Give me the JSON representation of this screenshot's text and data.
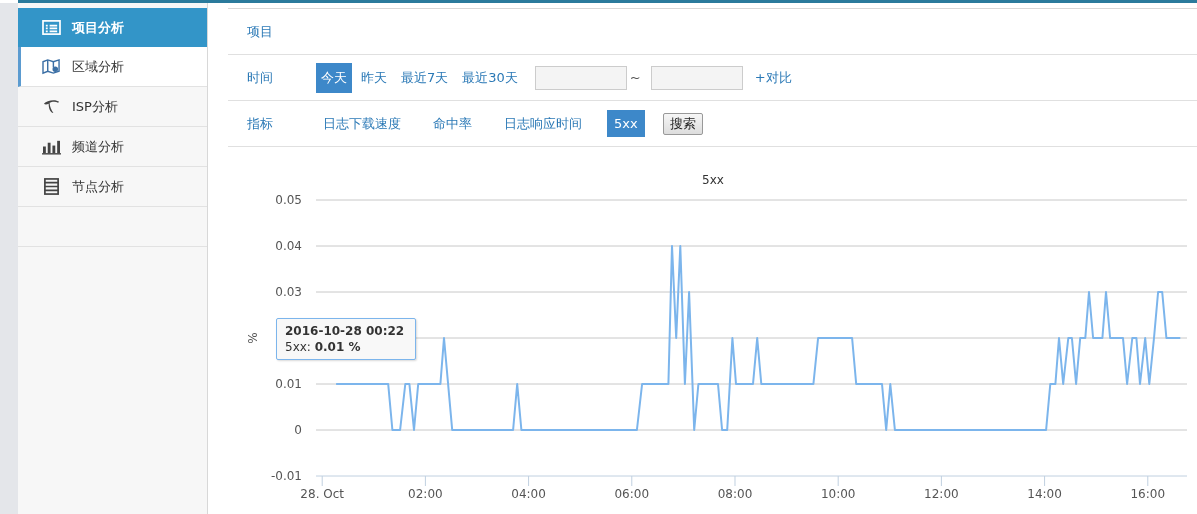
{
  "sidebar": {
    "items": [
      {
        "label": "项目分析",
        "kind": "list",
        "selected": true,
        "highlighted": false
      },
      {
        "label": "区域分析",
        "kind": "map",
        "selected": false,
        "highlighted": true
      },
      {
        "label": "ISP分析",
        "kind": "telecom",
        "selected": false,
        "highlighted": false
      },
      {
        "label": "频道分析",
        "kind": "bars",
        "selected": false,
        "highlighted": false
      },
      {
        "label": "节点分析",
        "kind": "server",
        "selected": false,
        "highlighted": false
      }
    ]
  },
  "filters": {
    "project": {
      "label": "项目"
    },
    "time": {
      "label": "时间",
      "options": [
        {
          "label": "今天",
          "selected": true
        },
        {
          "label": "昨天",
          "selected": false
        },
        {
          "label": "最近7天",
          "selected": false
        },
        {
          "label": "最近30天",
          "selected": false
        }
      ],
      "range_separator": "~",
      "compare": "+对比"
    },
    "metric": {
      "label": "指标",
      "options": [
        {
          "label": "日志下载速度",
          "selected": false
        },
        {
          "label": "命中率",
          "selected": false
        },
        {
          "label": "日志响应时间",
          "selected": false
        },
        {
          "label": "5xx",
          "selected": true
        }
      ],
      "search_button": "搜索"
    }
  },
  "chart": {
    "tooltip": {
      "title": "2016-10-28 00:22",
      "separator": ":",
      "value": "0.01 %"
    },
    "chart_data": {
      "type": "line",
      "grid": true,
      "title": "5xx",
      "ylabel": "%",
      "xlim": [
        -0.12,
        16.76
      ],
      "ylim": [
        -0.01,
        0.05
      ],
      "yticks": [
        -0.01,
        0,
        0.01,
        0.03,
        0.04,
        0.05
      ],
      "xticks": [
        {
          "value": 0,
          "label": "28. Oct"
        },
        {
          "value": 2,
          "label": "02:00"
        },
        {
          "value": 4,
          "label": "04:00"
        },
        {
          "value": 6,
          "label": "06:00"
        },
        {
          "value": 8,
          "label": "08:00"
        },
        {
          "value": 10,
          "label": "10:00"
        },
        {
          "value": 12,
          "label": "12:00"
        },
        {
          "value": 14,
          "label": "14:00"
        },
        {
          "value": 16,
          "label": "16:00"
        }
      ],
      "x": [
        0.27,
        1.28,
        1.36,
        1.51,
        1.61,
        1.69,
        1.78,
        1.86,
        2.29,
        2.36,
        2.52,
        3.7,
        3.78,
        3.86,
        6.1,
        6.2,
        6.71,
        6.78,
        6.86,
        6.94,
        7.03,
        7.11,
        7.21,
        7.29,
        7.67,
        7.75,
        7.85,
        7.95,
        8.02,
        8.35,
        8.43,
        8.51,
        9.52,
        9.61,
        10.27,
        10.35,
        10.85,
        10.93,
        11.01,
        11.1,
        14.03,
        14.11,
        14.21,
        14.28,
        14.36,
        14.46,
        14.53,
        14.61,
        14.69,
        14.79,
        14.86,
        14.94,
        15.12,
        15.19,
        15.27,
        15.52,
        15.6,
        15.7,
        15.78,
        15.85,
        15.95,
        16.03,
        16.12,
        16.2,
        16.28,
        16.36,
        16.63
      ],
      "series": [
        {
          "name": "5xx",
          "color": "#7cb5ec",
          "values": [
            0.01,
            0.01,
            0,
            0,
            0.01,
            0.01,
            0,
            0.01,
            0.01,
            0.02,
            0,
            0,
            0.01,
            0,
            0,
            0.01,
            0.01,
            0.04,
            0.02,
            0.04,
            0.01,
            0.03,
            0,
            0.01,
            0.01,
            0,
            0,
            0.02,
            0.01,
            0.01,
            0.02,
            0.01,
            0.01,
            0.02,
            0.02,
            0.01,
            0.01,
            0,
            0.01,
            0,
            0,
            0.01,
            0.01,
            0.02,
            0.01,
            0.02,
            0.02,
            0.01,
            0.02,
            0.02,
            0.03,
            0.02,
            0.02,
            0.03,
            0.02,
            0.02,
            0.01,
            0.02,
            0.02,
            0.01,
            0.02,
            0.01,
            0.02,
            0.03,
            0.03,
            0.02,
            0.02
          ]
        }
      ]
    }
  }
}
